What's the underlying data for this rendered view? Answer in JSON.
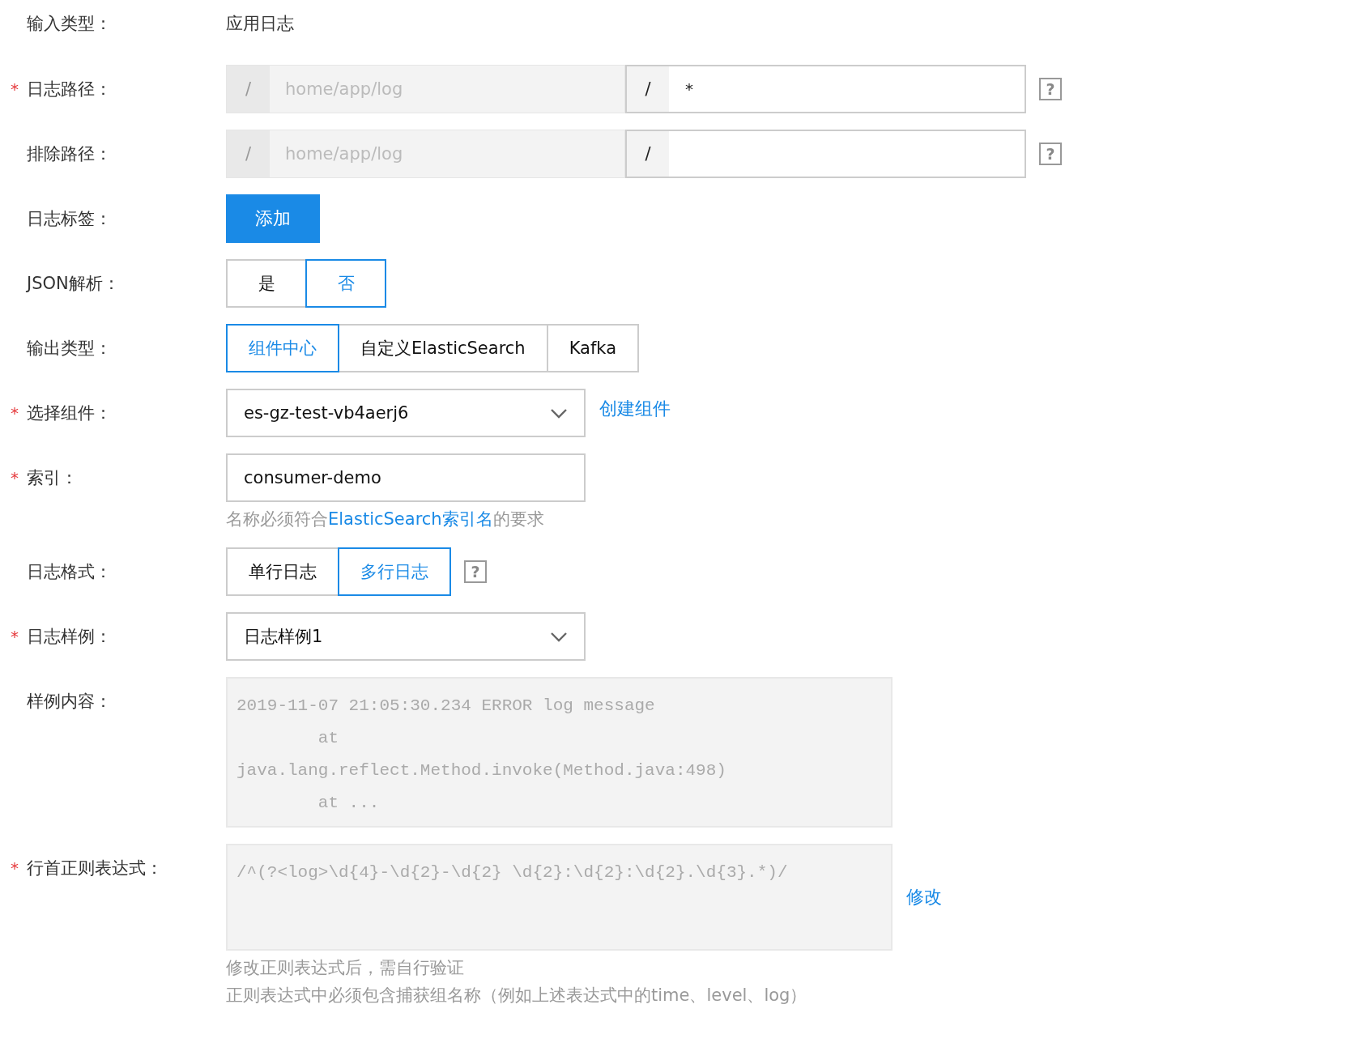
{
  "rows": [
    {
      "kind": "text",
      "label": "输入类型：",
      "required": false,
      "value": "应用日志"
    },
    {
      "kind": "path",
      "label": "日志路径：",
      "required": true,
      "prefix": "/",
      "placeholder": "home/app/log",
      "separator": "/",
      "value": "*",
      "help": "?"
    },
    {
      "kind": "path",
      "label": "排除路径：",
      "required": false,
      "prefix": "/",
      "placeholder": "home/app/log",
      "separator": "/",
      "help": "?"
    },
    {
      "kind": "button",
      "label": "日志标签：",
      "required": false,
      "button": "添加"
    },
    {
      "kind": "segmented",
      "label": "JSON解析：",
      "required": false,
      "options": [
        {
          "label": "是",
          "selected": false
        },
        {
          "label": "否",
          "selected": true
        }
      ]
    },
    {
      "kind": "segmented",
      "label": "输出类型：",
      "required": false,
      "options": [
        {
          "label": "组件中心",
          "selected": true
        },
        {
          "label": "自定义ElasticSearch",
          "selected": false
        },
        {
          "label": "Kafka",
          "selected": false
        }
      ]
    },
    {
      "kind": "select",
      "label": "选择组件：",
      "required": true,
      "value": "es-gz-test-vb4aerj6",
      "link": "创建组件"
    },
    {
      "kind": "input",
      "label": "索引：",
      "required": true,
      "value": "consumer-demo",
      "hint": {
        "before": "名称必须符合",
        "link": "ElasticSearch索引名",
        "after": "的要求"
      }
    },
    {
      "kind": "segmented",
      "label": "日志格式：",
      "required": false,
      "options": [
        {
          "label": "单行日志",
          "selected": false
        },
        {
          "label": "多行日志",
          "selected": true
        }
      ],
      "help": "?"
    },
    {
      "kind": "select",
      "label": "日志样例：",
      "required": true,
      "value": "日志样例1"
    },
    {
      "kind": "code",
      "label": "样例内容：",
      "required": false,
      "lines": [
        "2019-11-07 21:05:30.234 ERROR log message",
        "        at",
        "java.lang.reflect.Method.invoke(Method.java:498)",
        "        at ..."
      ]
    },
    {
      "kind": "regex",
      "label": "行首正则表达式：",
      "required": true,
      "value": "/^(?<log>\\d{4}-\\d{2}-\\d{2} \\d{2}:\\d{2}:\\d{2}.\\d{3}.*)/",
      "link": "修改",
      "notes": [
        "修改正则表达式后，需自行验证",
        "正则表达式中必须包含捕获组名称（例如上述表达式中的time、level、log）"
      ]
    }
  ]
}
